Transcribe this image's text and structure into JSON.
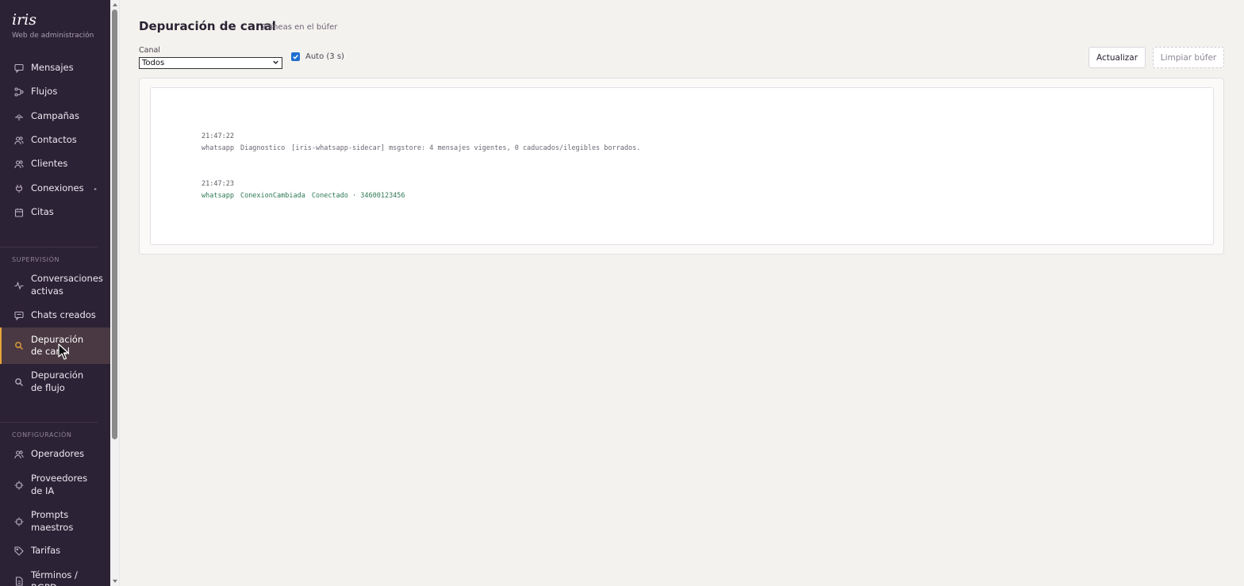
{
  "brand": {
    "name": "iris",
    "subtitle": "Web de administración"
  },
  "nav": {
    "main": [
      {
        "label": "Mensajes",
        "icon": "message-icon"
      },
      {
        "label": "Flujos",
        "icon": "flow-icon"
      },
      {
        "label": "Campañas",
        "icon": "campaign-icon"
      },
      {
        "label": "Contactos",
        "icon": "contacts-icon"
      },
      {
        "label": "Clientes",
        "icon": "clients-icon"
      },
      {
        "label": "Conexiones",
        "icon": "plug-icon",
        "caret": "▸"
      },
      {
        "label": "Citas",
        "icon": "calendar-icon"
      }
    ],
    "supervision_title": "SUPERVISIÓN",
    "supervision": [
      {
        "label": "Conversaciones activas",
        "icon": "activity-icon"
      },
      {
        "label": "Chats creados",
        "icon": "chat-icon"
      },
      {
        "label": "Depuración de canal",
        "icon": "search-icon",
        "active": true
      },
      {
        "label": "Depuración de flujo",
        "icon": "search-icon"
      }
    ],
    "config_title": "CONFIGURACIÓN",
    "config": [
      {
        "label": "Operadores",
        "icon": "operators-icon"
      },
      {
        "label": "Proveedores de IA",
        "icon": "chip-icon"
      },
      {
        "label": "Prompts maestros",
        "icon": "chip-icon"
      },
      {
        "label": "Tarifas",
        "icon": "tag-icon"
      },
      {
        "label": "Términos / RGPD",
        "icon": "document-icon"
      }
    ]
  },
  "page": {
    "title": "Depuración de canal",
    "buffer_count": "2 líneas en el búfer"
  },
  "filters": {
    "canal_label": "Canal",
    "canal_value": "Todos",
    "auto_label": "Auto (3 s)",
    "auto_checked": true
  },
  "actions": {
    "refresh": "Actualizar",
    "clear": "Limpiar búfer"
  },
  "logs": [
    {
      "time": "21:47:22",
      "channel": "whatsapp",
      "type": "Diagnostico",
      "message": "[iris-whatsapp-sidecar] msgstore: 4 mensajes vigentes, 0 caducados/ilegibles borrados.",
      "status": "info"
    },
    {
      "time": "21:47:23",
      "channel": "whatsapp",
      "type": "ConexionCambiada",
      "message": "Conectado · 34600123456",
      "status": "ok"
    }
  ],
  "colors": {
    "sidebar_bg": "#2c2235",
    "accent": "#e8a33a",
    "ok_text": "#2f7a55",
    "page_bg": "#f4f2ee"
  }
}
